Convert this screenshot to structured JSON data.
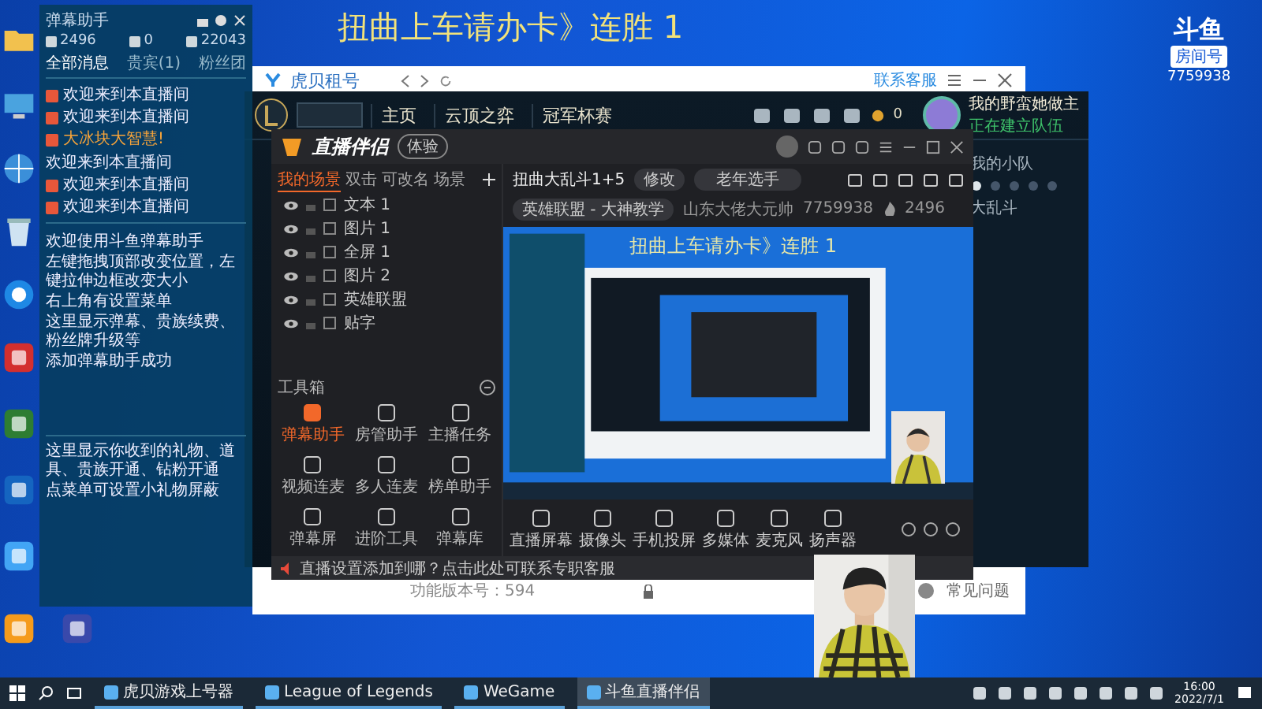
{
  "overlay": {
    "title": "扭曲上车请办卡》连胜 1",
    "logo": "斗鱼",
    "room_label": "房间号",
    "room_number": "7759938"
  },
  "chat_panel": {
    "title": "弹幕助手",
    "stats": [
      "2496",
      "0",
      "22043"
    ],
    "tabs": [
      {
        "label": "全部消息",
        "selected": true
      },
      {
        "label": "贵宾(1)",
        "selected": false
      },
      {
        "label": "粉丝团",
        "selected": false
      }
    ],
    "messages": [
      {
        "text": "欢迎来到本直播间"
      },
      {
        "text": "欢迎来到本直播间"
      },
      {
        "name": "大冰块大智慧!",
        "text": "欢迎来到本直播间"
      },
      {
        "text": "欢迎来到本直播间"
      },
      {
        "text": "欢迎来到本直播间"
      }
    ],
    "notes": [
      "欢迎使用斗鱼弹幕助手",
      "左键拖拽顶部改变位置，左键拉伸边框改变大小",
      "右上角有设置菜单",
      "这里显示弹幕、贵族续费、粉丝牌升级等",
      "添加弹幕助手成功"
    ],
    "gift_notes": [
      "这里显示你收到的礼物、道具、贵族开通、钻粉开通",
      "点菜单可设置小礼物屏蔽"
    ]
  },
  "hubei_window": {
    "title": "虎贝租号",
    "support": "联系客服",
    "version": "功能版本号：594",
    "help": "常见问题"
  },
  "lol_window": {
    "nav": [
      "主页",
      "云顶之弈",
      "冠军杯赛"
    ],
    "currency": "0",
    "player": "我的野蛮她做主",
    "status": "正在建立队伍",
    "party": "我的小队",
    "mode": "大乱斗"
  },
  "companion": {
    "logo": "直播伴侣",
    "badge": "体验",
    "scene_tabs": [
      {
        "label": "我的场景",
        "selected": true
      },
      {
        "label": "双击",
        "selected": false
      },
      {
        "label": "可改名",
        "selected": false
      },
      {
        "label": "场景",
        "selected": false
      }
    ],
    "sources": [
      "文本 1",
      "图片 1",
      "全屏 1",
      "图片 2",
      "英雄联盟",
      "贴字"
    ],
    "toolbox_title": "工具箱",
    "tools": [
      {
        "label": "弹幕助手",
        "selected": true
      },
      {
        "label": "房管助手",
        "selected": false
      },
      {
        "label": "主播任务",
        "selected": false
      },
      {
        "label": "视频连麦",
        "selected": false
      },
      {
        "label": "多人连麦",
        "selected": false
      },
      {
        "label": "榜单助手",
        "selected": false
      },
      {
        "label": "弹幕屏",
        "selected": false
      },
      {
        "label": "进阶工具",
        "selected": false
      },
      {
        "label": "弹幕库",
        "selected": false
      }
    ],
    "room_title": "扭曲大乱斗1+5",
    "edit": "修改",
    "tag": "老年选手",
    "category": "英雄联盟 - 大神教学",
    "host": "山东大佬大元帅",
    "room_id": "7759938",
    "fans": "2496",
    "controls": [
      "直播屏幕",
      "摄像头",
      "手机投屏",
      "多媒体",
      "麦克风",
      "扬声器"
    ],
    "notice": "直播设置添加到哪？点击此处可联系专职客服"
  },
  "preview": {
    "title": "扭曲上车请办卡》连胜 1"
  },
  "taskbar": {
    "apps": [
      {
        "label": "虎贝游戏上号器",
        "selected": false
      },
      {
        "label": "League of Legends",
        "selected": false
      },
      {
        "label": "WeGame",
        "selected": false
      },
      {
        "label": "斗鱼直播伴侣",
        "selected": true
      }
    ],
    "time": "16:00",
    "date": "2022/7/1"
  }
}
